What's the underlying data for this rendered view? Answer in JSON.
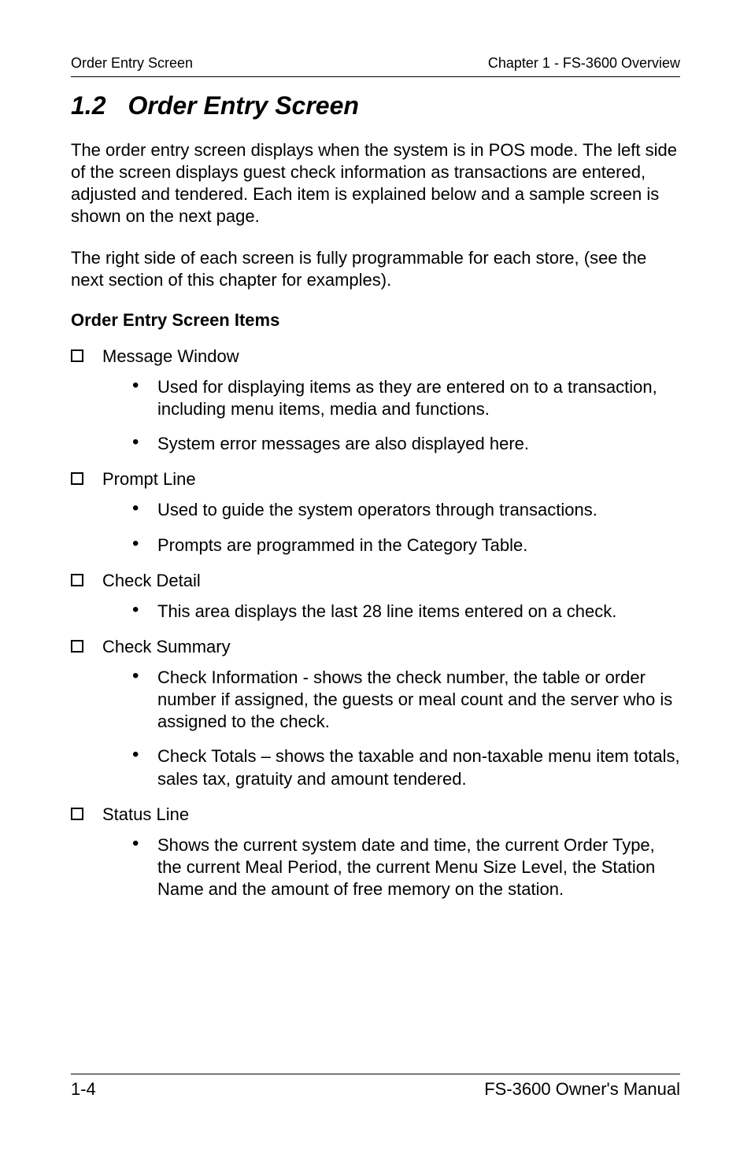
{
  "header": {
    "left": "Order Entry Screen",
    "right": "Chapter 1 - FS-3600 Overview"
  },
  "section": {
    "number": "1.2",
    "title": "Order Entry Screen"
  },
  "intro": [
    "The order entry screen displays when the system is in POS mode.  The left side of the screen displays guest check information as transactions are entered, adjusted and tendered.  Each item is explained below and a sample screen is shown on the next page.",
    "The right side of each screen is fully programmable for each store, (see the next section of this chapter for examples)."
  ],
  "subhead": "Order Entry Screen Items",
  "items": [
    {
      "label": "Message Window",
      "points": [
        "Used for displaying items as they are entered on to a transaction, including menu items, media and functions.",
        "System error messages are also displayed here."
      ]
    },
    {
      "label": "Prompt Line",
      "points": [
        "Used to guide the system operators through transactions.",
        "Prompts are programmed in the Category Table."
      ]
    },
    {
      "label": "Check Detail",
      "points": [
        "This area displays the last 28 line items entered on a check."
      ]
    },
    {
      "label": "Check Summary",
      "points": [
        "Check Information - shows the check number, the table or order number if assigned, the guests or meal count and the server who is assigned to the check.",
        "Check Totals – shows the taxable and non-taxable menu item totals, sales tax, gratuity and amount tendered."
      ]
    },
    {
      "label": "Status Line",
      "points": [
        "Shows the current system date and time, the current Order Type, the current Meal Period, the current Menu Size Level, the Station Name and the amount of free memory on the station."
      ]
    }
  ],
  "footer": {
    "left": "1-4",
    "right": "FS-3600 Owner's Manual"
  }
}
